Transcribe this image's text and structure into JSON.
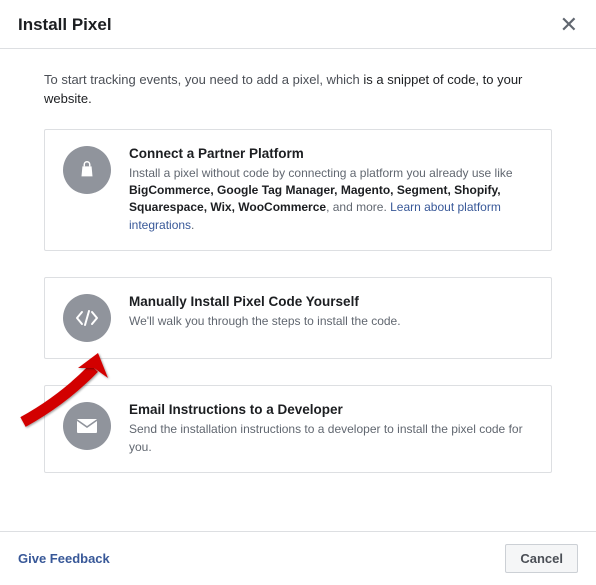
{
  "header": {
    "title": "Install Pixel"
  },
  "intro": {
    "pre": "To start tracking events, you need to add a pixel, which ",
    "bold": "is a snippet of code, to your website.",
    "post": ""
  },
  "cards": {
    "partner": {
      "title": "Connect a Partner Platform",
      "desc_pre": "Install a pixel without code by connecting a platform you already use like ",
      "platforms": "BigCommerce, Google Tag Manager, Magento, Segment, Shopify, Squarespace, Wix, WooCommerce",
      "desc_mid": ", and more. ",
      "link": "Learn about platform integrations",
      "desc_post": "."
    },
    "manual": {
      "title": "Manually Install Pixel Code Yourself",
      "desc": "We'll walk you through the steps to install the code."
    },
    "email": {
      "title": "Email Instructions to a Developer",
      "desc": "Send the installation instructions to a developer to install the pixel code for you."
    }
  },
  "footer": {
    "feedback": "Give Feedback",
    "cancel": "Cancel"
  }
}
